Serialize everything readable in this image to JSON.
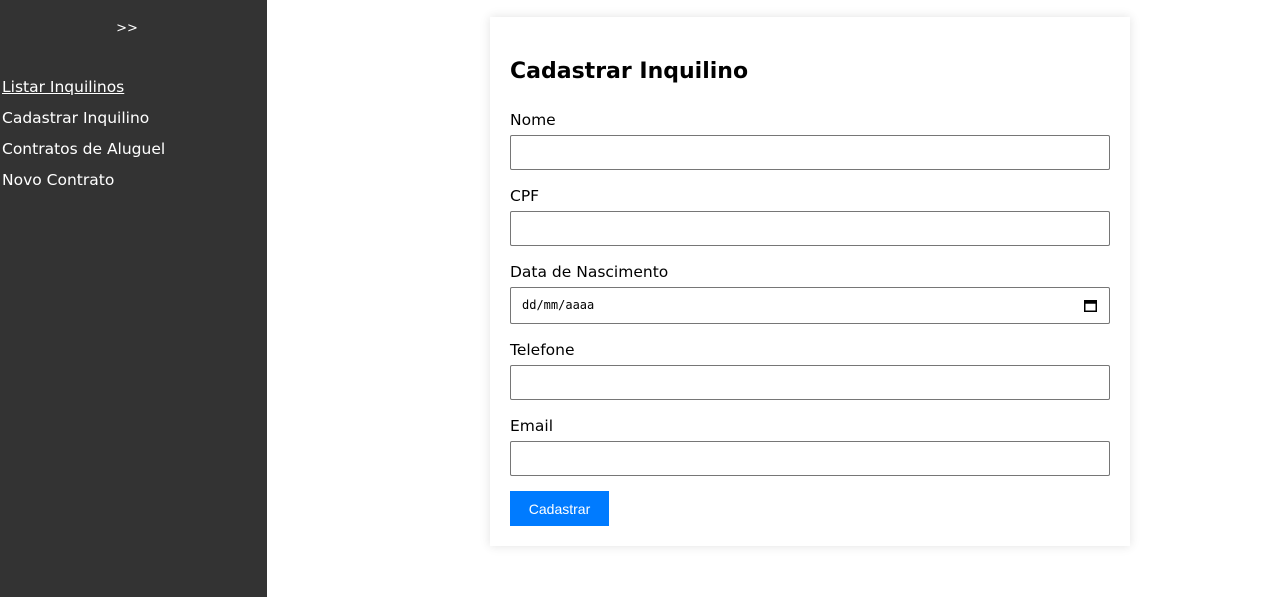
{
  "sidebar": {
    "toggle_label": ">>",
    "items": [
      {
        "label": "Listar Inquilinos",
        "active": true
      },
      {
        "label": "Cadastrar Inquilino",
        "active": false
      },
      {
        "label": "Contratos de Aluguel",
        "active": false
      },
      {
        "label": "Novo Contrato",
        "active": false
      }
    ]
  },
  "form": {
    "title": "Cadastrar Inquilino",
    "fields": {
      "nome": {
        "label": "Nome",
        "value": ""
      },
      "cpf": {
        "label": "CPF",
        "value": ""
      },
      "nascimento": {
        "label": "Data de Nascimento",
        "placeholder": "dd/mm/aaaa",
        "icon": "calendar-icon"
      },
      "telefone": {
        "label": "Telefone",
        "value": ""
      },
      "email": {
        "label": "Email",
        "value": ""
      }
    },
    "submit_label": "Cadastrar"
  },
  "colors": {
    "sidebar_bg": "#333333",
    "button_bg": "#007bff",
    "text": "#000000"
  }
}
